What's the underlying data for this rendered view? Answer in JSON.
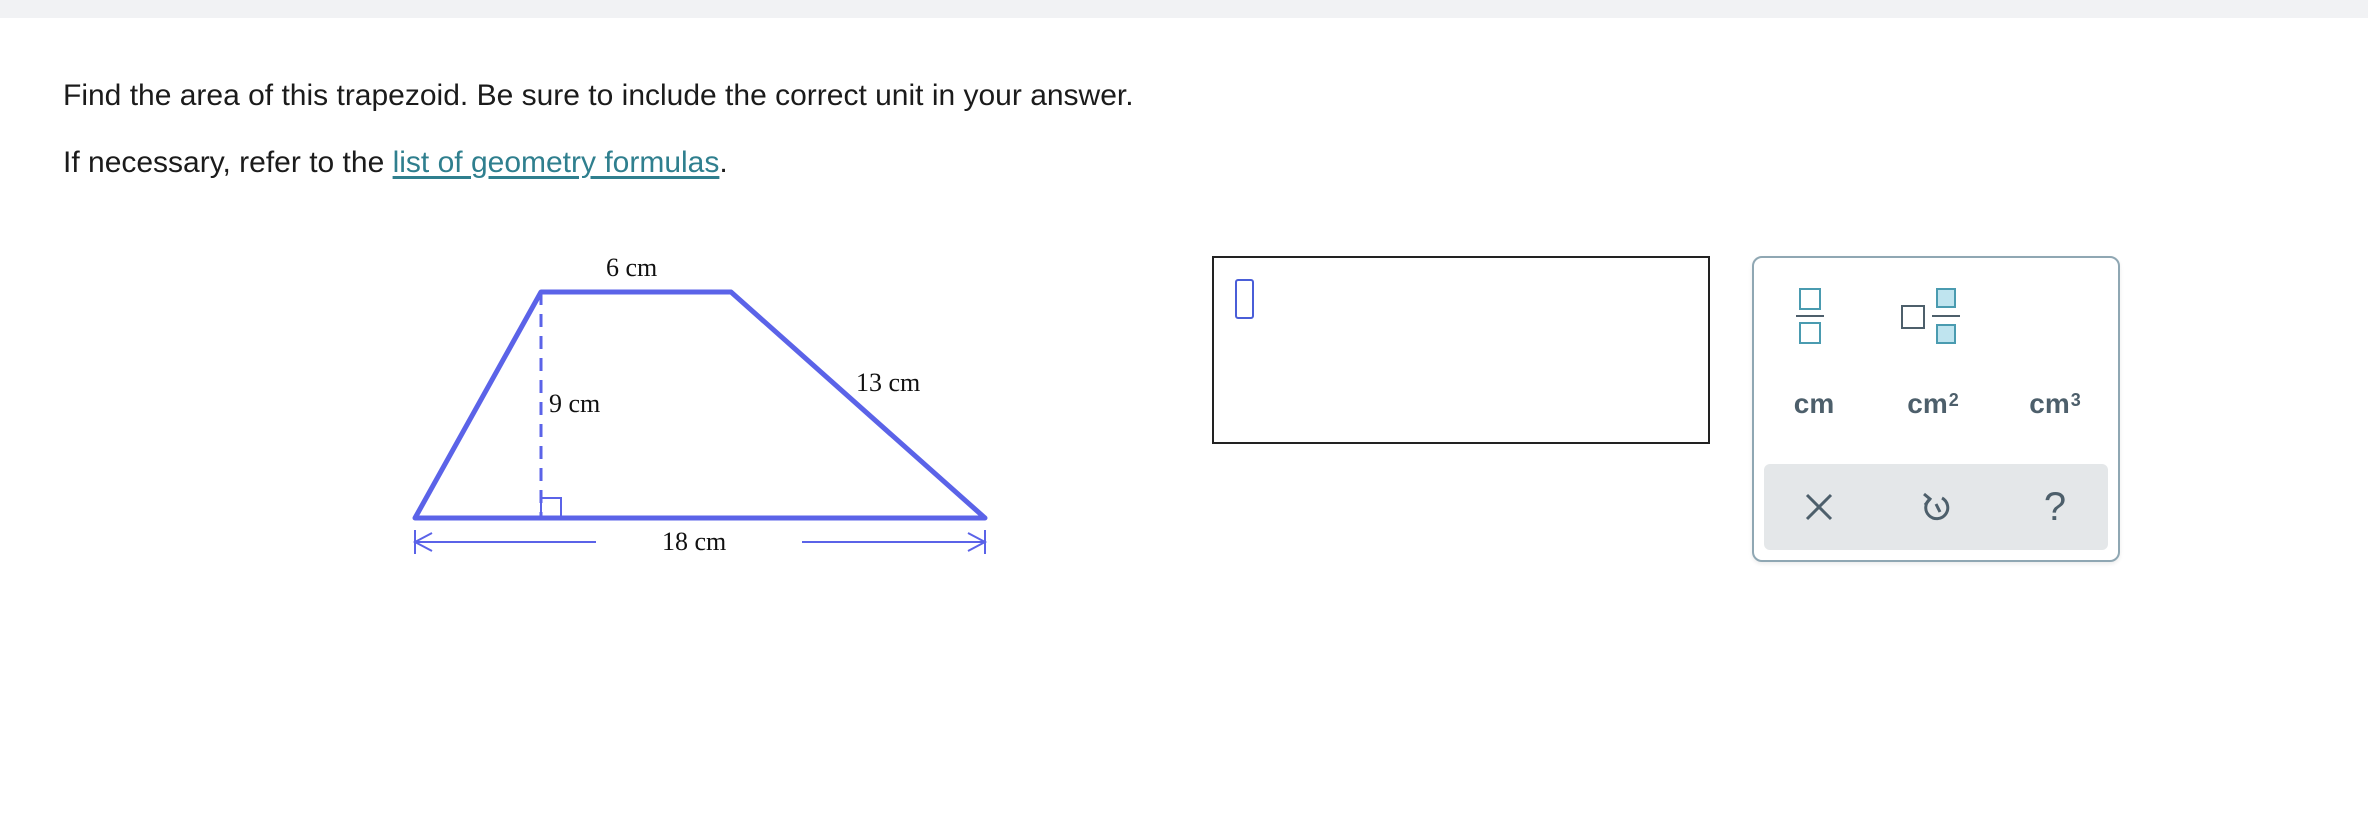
{
  "question": {
    "line1": "Find the area of this trapezoid. Be sure to include the correct unit in your answer.",
    "line2_prefix": "If necessary, refer to the ",
    "line2_link": "list of geometry formulas",
    "line2_suffix": "."
  },
  "figure": {
    "top_label": "6 cm",
    "height_label": "9 cm",
    "slant_label": "13 cm",
    "base_label": "18 cm",
    "color": "#5b63e8"
  },
  "answer": {
    "value": ""
  },
  "keypad": {
    "fraction_icon": "fraction-icon",
    "mixed_number_icon": "mixed-number-icon",
    "unit_cm": "cm",
    "unit_cm2_base": "cm",
    "unit_cm2_exp": "2",
    "unit_cm3_base": "cm",
    "unit_cm3_exp": "3",
    "clear_icon": "close-icon",
    "undo_icon": "undo-icon",
    "help_label": "?",
    "accent_color": "#4a9bb0",
    "icon_color": "#4d5f6b"
  }
}
